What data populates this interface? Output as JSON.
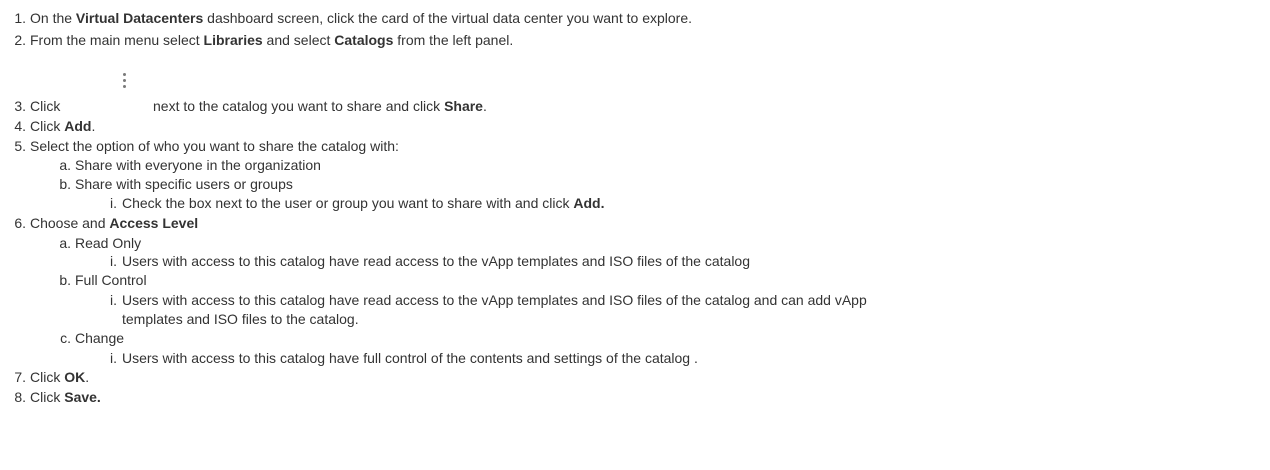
{
  "steps": [
    {
      "num": "1.",
      "pre": "On the ",
      "bold": "Virtual Datacenters",
      "post": " dashboard screen, click the card of the virtual data center you want to explore."
    },
    {
      "num": "2.",
      "pre": "From the main menu select ",
      "bold": "Libraries",
      "mid": " and select ",
      "bold2": "Catalogs",
      "post": " from the left panel."
    },
    {
      "num": "3.",
      "pre": "Click",
      "mid": "next to the catalog you want to share and click ",
      "bold": "Share",
      "post": "."
    },
    {
      "num": "4.",
      "pre": "Click ",
      "bold": "Add",
      "post": "."
    },
    {
      "num": "5.",
      "pre": "Select the option of who you want to share the catalog with:"
    },
    {
      "num": "6.",
      "pre": "Choose and ",
      "bold": "Access Level"
    },
    {
      "num": "7.",
      "pre": "Click ",
      "bold": "OK",
      "post": "."
    },
    {
      "num": "8.",
      "pre": "Click ",
      "bold": "Save."
    }
  ],
  "step5": {
    "a": {
      "num": "a.",
      "text": "Share with everyone in the organization"
    },
    "b": {
      "num": "b.",
      "text": "Share with specific users or groups"
    },
    "b_i": {
      "num": "i.",
      "pre": "Check the box next to the user or group you want to share with and click ",
      "bold": "Add."
    }
  },
  "step6": {
    "a": {
      "num": "a.",
      "text": "Read Only"
    },
    "a_i": {
      "num": "i.",
      "text": "Users with access to this catalog have read access to the vApp templates and ISO files of the catalog"
    },
    "b": {
      "num": "b.",
      "text": "Full Control"
    },
    "b_i": {
      "num": "i.",
      "text1": "Users with access to this catalog have read access to the vApp templates and ISO files of the catalog and can add vApp",
      "text2": "templates and ISO files to the catalog."
    },
    "c": {
      "num": "c.",
      "text": "Change"
    },
    "c_i": {
      "num": "i.",
      "text": "Users with access to this catalog have full control of the contents and settings of the catalog ."
    }
  },
  "icons": {
    "kebab": "more-vertical-icon"
  }
}
